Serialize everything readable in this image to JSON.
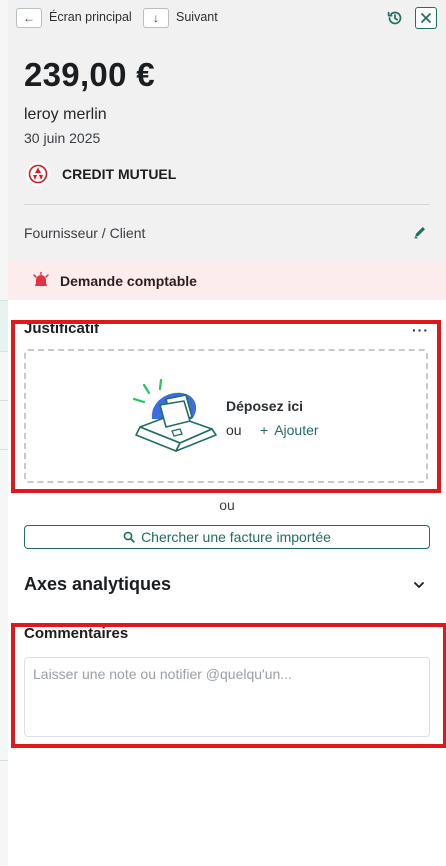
{
  "topbar": {
    "back_arrow": "←",
    "back_label": "Écran principal",
    "next_arrow": "↓",
    "next_label": "Suivant",
    "history_icon": "history-icon",
    "close_icon": "close-icon"
  },
  "transaction": {
    "amount": "239,00 €",
    "merchant": "leroy merlin",
    "date": "30 juin 2025",
    "bank": "CREDIT MUTUEL",
    "supplier_label": "Fournisseur / Client"
  },
  "alert": {
    "label": "Demande comptable",
    "color": "#fdecee",
    "icon_color": "#e0343e"
  },
  "justificatif": {
    "title": "Justificatif",
    "more": "···",
    "drop_title": "Déposez ici",
    "drop_or": "ou",
    "add_label": "Ajouter",
    "add_plus": "+",
    "or_between": "ou",
    "search_label": "Chercher une facture importée"
  },
  "axes": {
    "title": "Axes analytiques"
  },
  "comments": {
    "title": "Commentaires",
    "placeholder": "Laisser une note ou notifier @quelqu'un..."
  },
  "colors": {
    "accent": "#1f6f62",
    "annotation_red": "#e0171b"
  }
}
